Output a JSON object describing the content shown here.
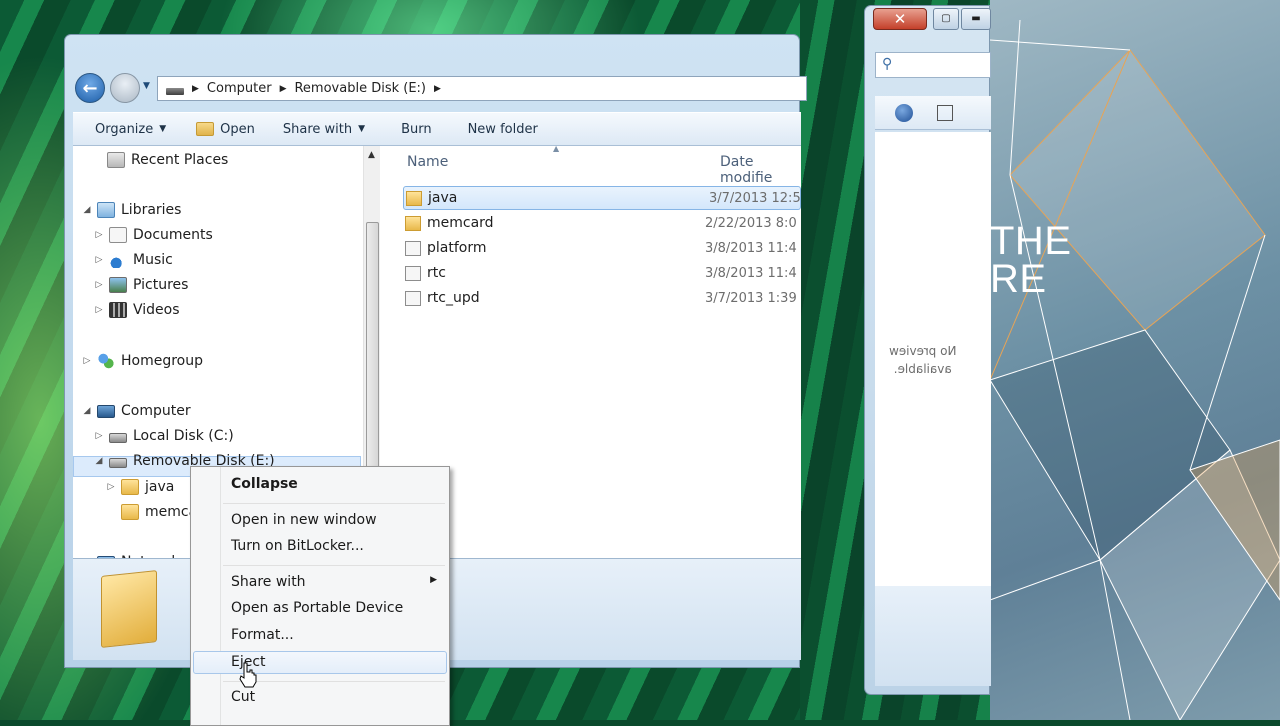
{
  "address_bar": {
    "crumbs": [
      "Computer",
      "Removable Disk (E:)"
    ]
  },
  "toolbar": {
    "organize": "Organize",
    "open": "Open",
    "share_with": "Share with",
    "burn": "Burn",
    "new_folder": "New folder"
  },
  "nav_pane": {
    "recent_places": "Recent Places",
    "libraries": "Libraries",
    "documents": "Documents",
    "music": "Music",
    "pictures": "Pictures",
    "videos": "Videos",
    "homegroup": "Homegroup",
    "computer": "Computer",
    "local_disk": "Local Disk (C:)",
    "removable_disk": "Removable Disk (E:)",
    "java": "java",
    "memcard": "memca",
    "network": "Network"
  },
  "file_list": {
    "col_name": "Name",
    "col_date": "Date modifie",
    "rows": [
      {
        "name": "java",
        "date": "3/7/2013 12:5"
      },
      {
        "name": "memcard",
        "date": "2/22/2013 8:0"
      },
      {
        "name": "platform",
        "date": "3/8/2013 11:4"
      },
      {
        "name": "rtc",
        "date": "3/8/2013 11:4"
      },
      {
        "name": "rtc_upd",
        "date": "3/7/2013 1:39"
      }
    ]
  },
  "context_menu": {
    "collapse": "Collapse",
    "open_new_window": "Open in new window",
    "bitlocker": "Turn on BitLocker...",
    "share_with": "Share with",
    "portable": "Open as Portable Device",
    "format": "Format...",
    "eject": "Eject",
    "cut": "Cut"
  },
  "second_window": {
    "close": "✕",
    "preview_line1": "No preview",
    "preview_line2": "available."
  },
  "poster": {
    "line1": "THE",
    "line2": "RE"
  },
  "colors": {
    "selection": "#dcebfc",
    "accent": "#1d5ea8"
  }
}
